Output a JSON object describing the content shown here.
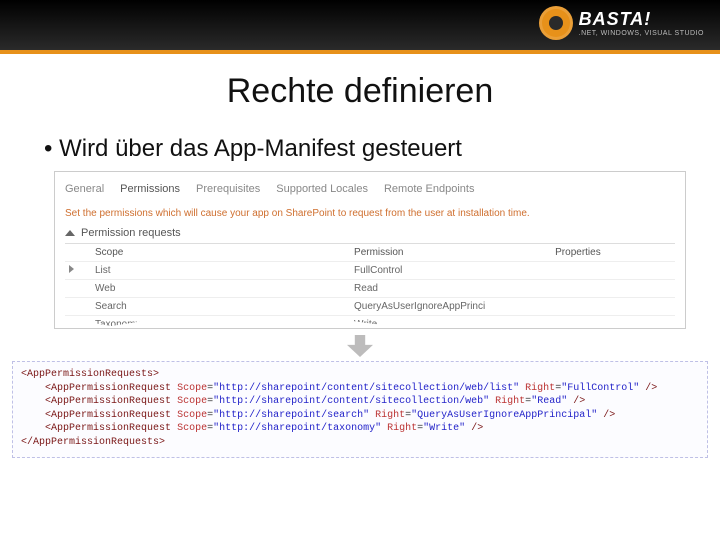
{
  "header": {
    "brand": "BASTA!",
    "subtitle": ".NET, WINDOWS, VISUAL STUDIO"
  },
  "title": "Rechte definieren",
  "bullet": "Wird über das App-Manifest gesteuert",
  "manifest": {
    "tabs": [
      "General",
      "Permissions",
      "Prerequisites",
      "Supported Locales",
      "Remote Endpoints"
    ],
    "active_tab_index": 1,
    "description": "Set the permissions which will cause your app on SharePoint to request from the user at installation time.",
    "accordion_title": "Permission requests",
    "columns": [
      "Scope",
      "Permission",
      "Properties"
    ],
    "rows": [
      {
        "scope": "List",
        "permission": "FullControl",
        "props": ""
      },
      {
        "scope": "Web",
        "permission": "Read",
        "props": ""
      },
      {
        "scope": "Search",
        "permission": "QueryAsUserIgnoreAppPrinci",
        "props": ""
      },
      {
        "scope": "Taxonomy",
        "permission": "Write",
        "props": ""
      }
    ]
  },
  "code": {
    "open": "<AppPermissionRequests>",
    "lines": [
      {
        "scope": "http://sharepoint/content/sitecollection/web/list",
        "right": "FullControl"
      },
      {
        "scope": "http://sharepoint/content/sitecollection/web",
        "right": "Read"
      },
      {
        "scope": "http://sharepoint/search",
        "right": "QueryAsUserIgnoreAppPrincipal"
      },
      {
        "scope": "http://sharepoint/taxonomy",
        "right": "Write"
      }
    ],
    "close": "</AppPermissionRequests>"
  }
}
